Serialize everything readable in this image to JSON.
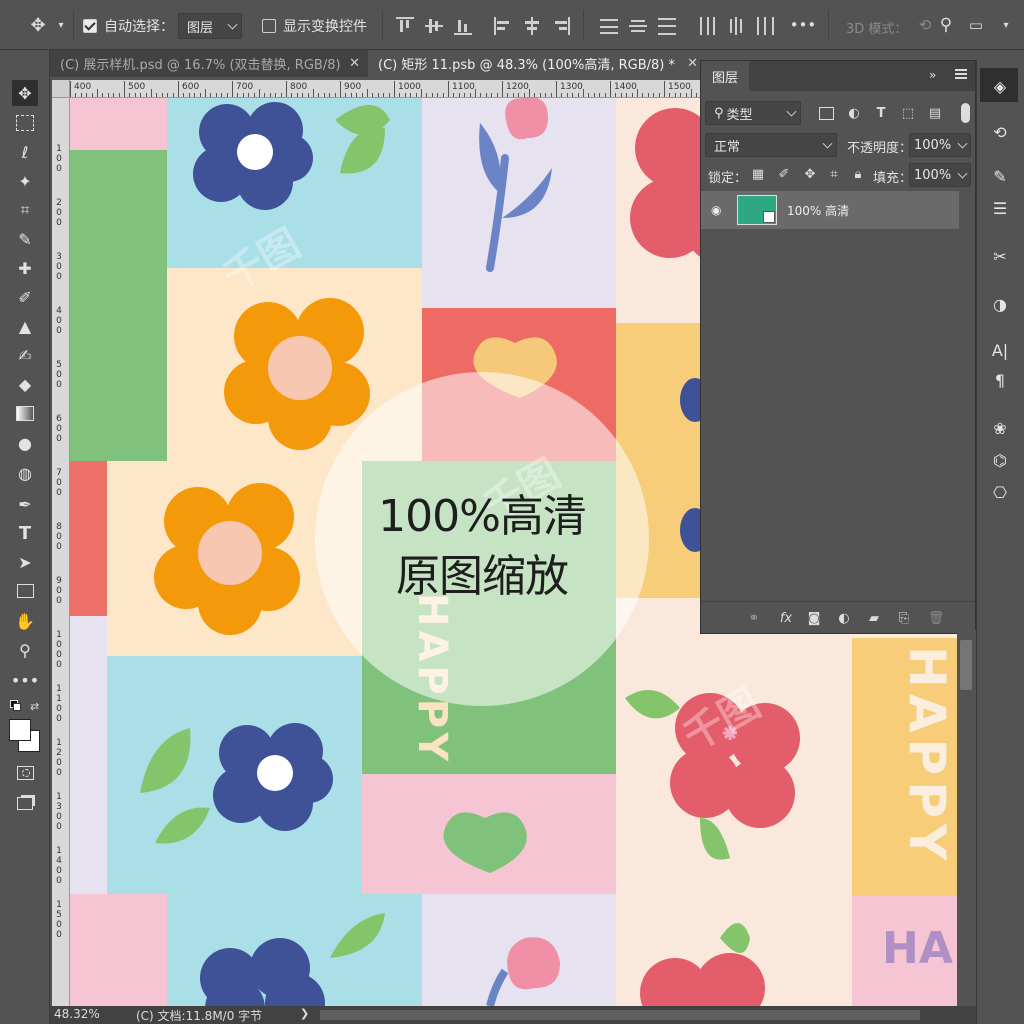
{
  "options_bar": {
    "auto_select_label": "自动选择：",
    "auto_select_checked": true,
    "auto_select_target": "图层",
    "show_transform_label": "显示变换控件",
    "show_transform_checked": false,
    "mode_3d_label": "3D 模式："
  },
  "tabs": [
    {
      "label": "(C) 展示样机.psd @ 16.7% (双击替换, RGB/8)",
      "active": false
    },
    {
      "label": "(C) 矩形 11.psb @ 48.3% (100%高清, RGB/8) *",
      "active": true
    }
  ],
  "ruler_top": [
    "400",
    "500",
    "600",
    "700",
    "800",
    "900",
    "1000",
    "1100",
    "1200",
    "1300",
    "1400",
    "1500"
  ],
  "ruler_left": [
    "1 0 0",
    "2 0 0",
    "3 0 0",
    "4 0 0",
    "5 0 0",
    "6 0 0",
    "7 0 0",
    "8 0 0",
    "9 0 0",
    "1 0 0 0",
    "1 1 0 0",
    "1 2 0 0",
    "1 3 0 0",
    "1 4 0 0",
    "1 5 0 0"
  ],
  "canvas": {
    "overlay_line1": "100%高清",
    "overlay_line2": "原图缩放",
    "happy_text": "HAPPY",
    "happy_partial": "HA",
    "watermark": "千图"
  },
  "layers_panel": {
    "tab_label": "图层",
    "filter_kind": "类型",
    "blend_mode": "正常",
    "opacity_label": "不透明度：",
    "opacity_value": "100%",
    "lock_label": "锁定：",
    "fill_label": "填充：",
    "fill_value": "100%",
    "layers": [
      {
        "name": "100% 高清",
        "visible": true,
        "thumb_color": "#2ea882"
      }
    ]
  },
  "status": {
    "zoom": "48.32%",
    "doc_info": "(C) 文档:11.8M/0 字节"
  },
  "colors": {
    "ui_bg": "#535353",
    "ui_dark": "#424242",
    "foreground": "#ffffff",
    "background": "#ffffff"
  }
}
